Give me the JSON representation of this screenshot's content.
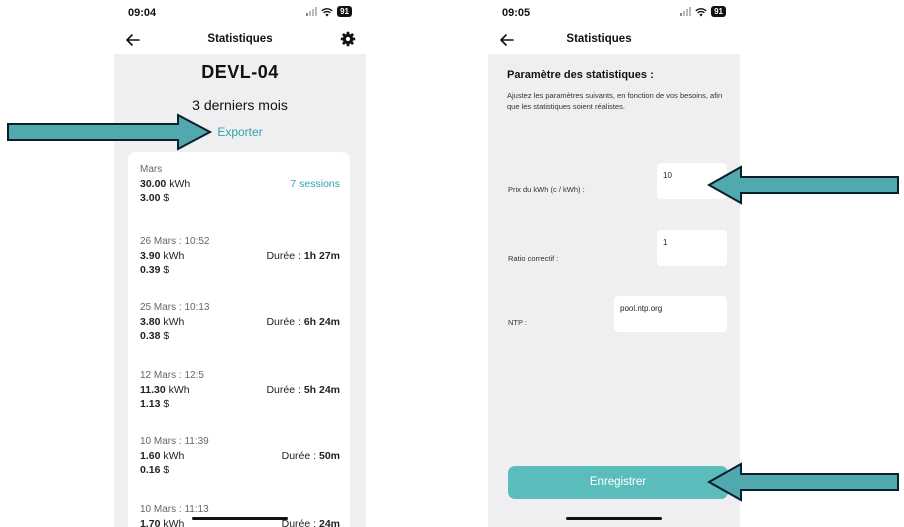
{
  "colors": {
    "accent": "#2fa3b0",
    "button": "#5bbcbc",
    "arrow_fill": "#4fa9ae",
    "screen_bg": "#efeff1"
  },
  "phone_left": {
    "status": {
      "time": "09:04",
      "battery": "91"
    },
    "nav": {
      "title": "Statistiques",
      "back_icon": "arrow-left-icon",
      "settings_icon": "gear-icon"
    },
    "device_name": "DEVL-04",
    "period": "3 derniers mois",
    "export_label": "Exporter",
    "summary": {
      "month": "Mars",
      "kwh_value": "30.00",
      "kwh_unit": "kWh",
      "cost_value": "3.00",
      "cost_unit": "$",
      "sessions": "7 sessions"
    },
    "duration_label": "Durée :",
    "sessions": [
      {
        "date": "26 Mars : 10:52",
        "kwh": "3.90",
        "cost": "0.39",
        "duration": "1h 27m"
      },
      {
        "date": "25 Mars : 10:13",
        "kwh": "3.80",
        "cost": "0.38",
        "duration": "6h 24m"
      },
      {
        "date": "12 Mars : 12:5",
        "kwh": "11.30",
        "cost": "1.13",
        "duration": "5h 24m"
      },
      {
        "date": "10 Mars : 11:39",
        "kwh": "1.60",
        "cost": "0.16",
        "duration": "50m"
      },
      {
        "date": "10 Mars : 11:13",
        "kwh": "1.70",
        "cost": "",
        "duration": "24m"
      }
    ],
    "unit_kwh": "kWh",
    "unit_cost": "$"
  },
  "phone_right": {
    "status": {
      "time": "09:05",
      "battery": "91"
    },
    "nav": {
      "title": "Statistiques",
      "back_icon": "arrow-left-icon"
    },
    "param_title": "Paramètre des statistiques :",
    "param_desc": "Ajustez les paramètres suivants, en fonction de vos besoins, afin que les statistiques soient réalistes.",
    "fields": {
      "price": {
        "label": "Prix du kWh (c / kWh) :",
        "value": "10"
      },
      "ratio": {
        "label": "Ratio correctif :",
        "value": "1"
      },
      "ntp": {
        "label": "NTP :",
        "value": "pool.ntp.org"
      }
    },
    "save_label": "Enregistrer"
  }
}
